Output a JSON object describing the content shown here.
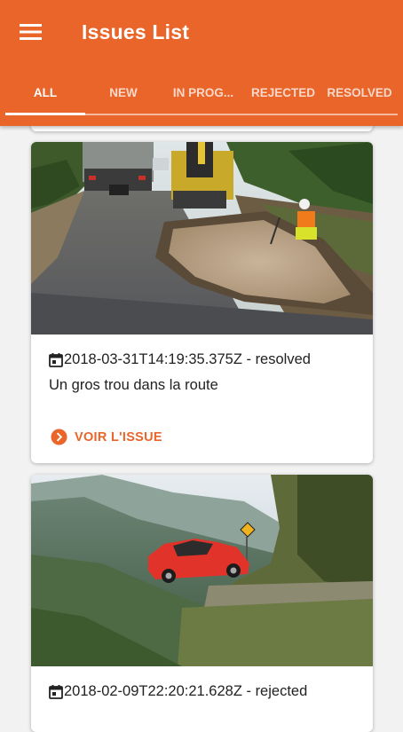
{
  "appbar": {
    "title": "Issues List",
    "menu_icon": "hamburger-menu-icon",
    "color": "#e9652a"
  },
  "tabs": [
    {
      "label": "ALL",
      "active": true
    },
    {
      "label": "NEW",
      "active": false
    },
    {
      "label": "IN PROG...",
      "active": false
    },
    {
      "label": "REJECTED",
      "active": false
    },
    {
      "label": "RESOLVED",
      "active": false
    }
  ],
  "issues": [
    {
      "meta": "2018-03-31T14:19:35.375Z - resolved",
      "description": "Un gros trou dans la route",
      "action_label": "VOIR L'ISSUE",
      "image_subject": "road-pothole-photo"
    },
    {
      "meta": "2018-02-09T22:20:21.628Z - rejected",
      "description": "",
      "image_subject": "car-cliff-photo"
    }
  ],
  "colors": {
    "accent": "#e9652a",
    "background": "#f2f2f2",
    "card": "#ffffff"
  }
}
